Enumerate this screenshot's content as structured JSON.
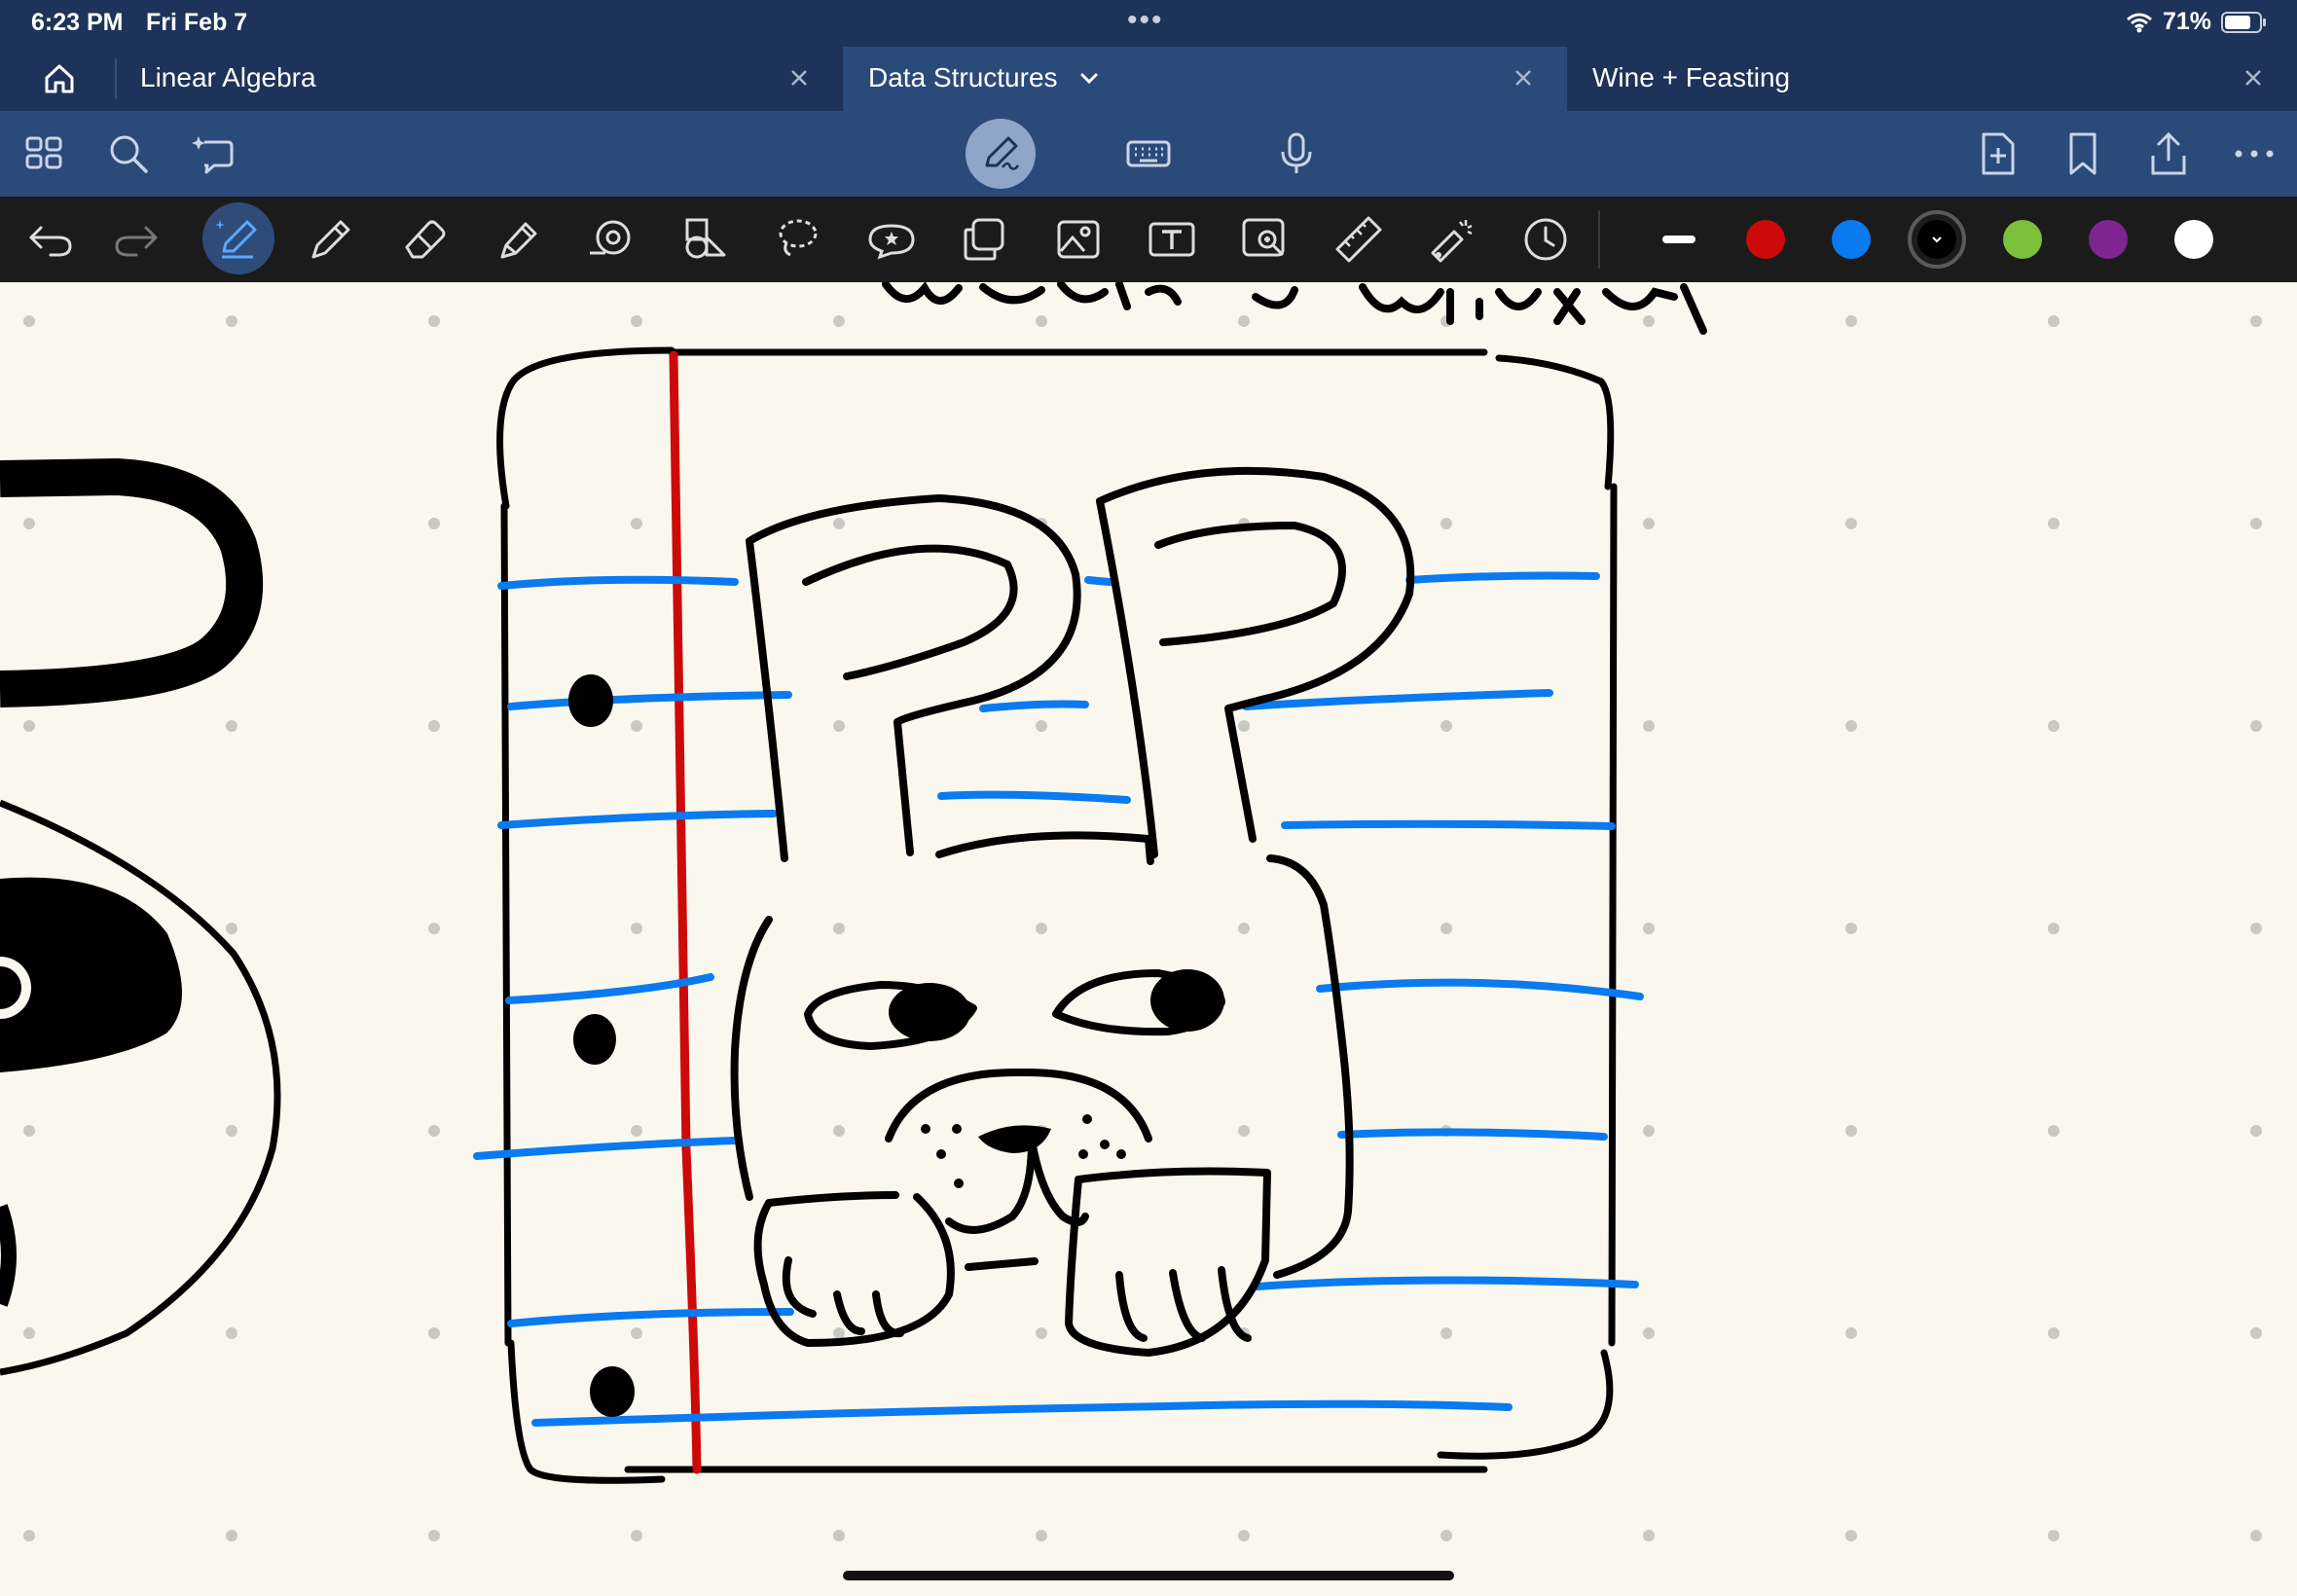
{
  "status_bar": {
    "time": "6:23 PM",
    "date": "Fri Feb 7",
    "battery": "71%",
    "icons": [
      "wifi-icon",
      "battery-icon",
      "more-dots-icon"
    ]
  },
  "tabs": [
    {
      "label": "Linear Algebra",
      "active": false
    },
    {
      "label": "Data Structures",
      "active": true
    },
    {
      "label": "Wine + Feasting",
      "active": false
    }
  ],
  "toolbar_top": {
    "left_icons": [
      "thumbnails-icon",
      "search-icon",
      "ai-assist-icon"
    ],
    "center_icons": [
      "pen-mode-icon",
      "keyboard-icon",
      "microphone-icon"
    ],
    "right_icons": [
      "add-page-icon",
      "bookmark-icon",
      "share-icon",
      "more-icon"
    ]
  },
  "tools": {
    "items": [
      "undo-icon",
      "redo-icon",
      "pen-icon",
      "pencil-icon",
      "eraser-icon",
      "highlighter-icon",
      "tape-icon",
      "shapes-icon",
      "lasso-icon",
      "sticker-icon",
      "element-icon",
      "image-icon",
      "text-box-icon",
      "zoom-window-icon",
      "ruler-icon",
      "laser-pointer-icon",
      "history-icon"
    ],
    "selected": "pen-icon"
  },
  "colors": {
    "swatches": [
      "#ffffff",
      "#cc0a0a",
      "#0a7af0",
      "#000000",
      "#7cc03a",
      "#7f2592",
      "#ffffff"
    ],
    "selected_color": "#000000",
    "chrome_dark": "#1e3359",
    "chrome_mid": "#2a4a7a",
    "paper": "#faf8ee"
  }
}
